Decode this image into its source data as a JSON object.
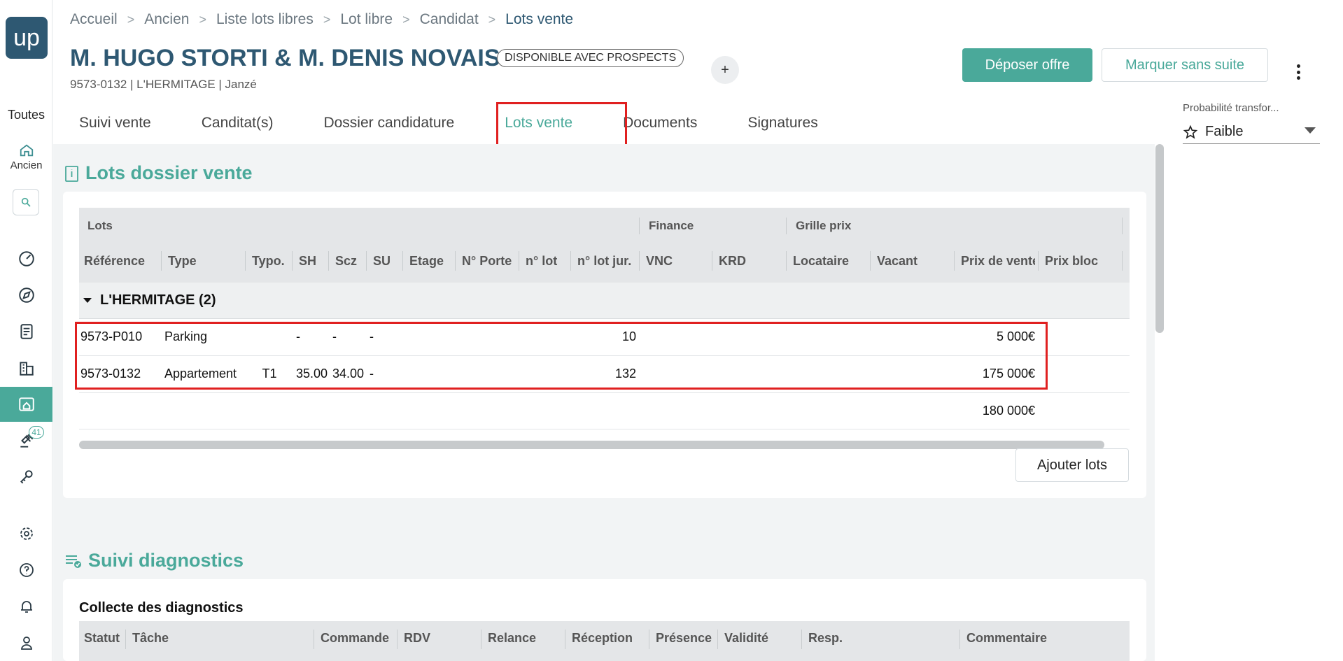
{
  "sidebar": {
    "logo": "up",
    "toutes": "Toutes",
    "home_label": "Ancien",
    "badge_count": "41"
  },
  "breadcrumb": [
    "Accueil",
    "Ancien",
    "Liste lots libres",
    "Lot libre",
    "Candidat",
    "Lots vente"
  ],
  "header": {
    "title": "M. HUGO STORTI & M. DENIS NOVAIS",
    "status": "DISPONIBLE AVEC PROSPECTS",
    "plus": "+",
    "subtitle": "9573-0132 | L'HERMITAGE | Janzé",
    "btn_deposer": "Déposer offre",
    "btn_marquer": "Marquer sans suite"
  },
  "probabilite": {
    "label": "Probabilité transfor...",
    "value": "Faible"
  },
  "tabs": [
    "Suivi vente",
    "Canditat(s)",
    "Dossier candidature",
    "Lots vente",
    "Documents",
    "Signatures"
  ],
  "active_tab": "Lots vente",
  "lots_section": {
    "title": "Lots dossier vente",
    "groups": [
      "Lots",
      "Finance",
      "Grille prix"
    ],
    "columns": [
      "Référence",
      "Type",
      "Typo.",
      "SH",
      "Scz",
      "SU",
      "Etage",
      "N° Porte",
      "n° lot",
      "n° lot jur.",
      "VNC",
      "KRD",
      "Locataire",
      "Vacant",
      "Prix de vente",
      "Prix bloc"
    ],
    "group_row": "L'HERMITAGE (2)",
    "rows": [
      {
        "ref": "9573-P010",
        "type": "Parking",
        "typo": "",
        "sh": "-",
        "scz": "-",
        "su": "-",
        "lot_jur": "10",
        "prix": "5 000€"
      },
      {
        "ref": "9573-0132",
        "type": "Appartement",
        "typo": "T1",
        "sh": "35.00",
        "scz": "34.00",
        "su": "-",
        "lot_jur": "132",
        "prix": "175 000€"
      }
    ],
    "total": "180 000€",
    "btn_add": "Ajouter lots"
  },
  "diag_section": {
    "title": "Suivi diagnostics",
    "subtitle": "Collecte des diagnostics",
    "columns": [
      "Statut",
      "Tâche",
      "Commande",
      "RDV",
      "Relance",
      "Réception",
      "Présence",
      "Validité",
      "Resp.",
      "Commentaire"
    ]
  }
}
